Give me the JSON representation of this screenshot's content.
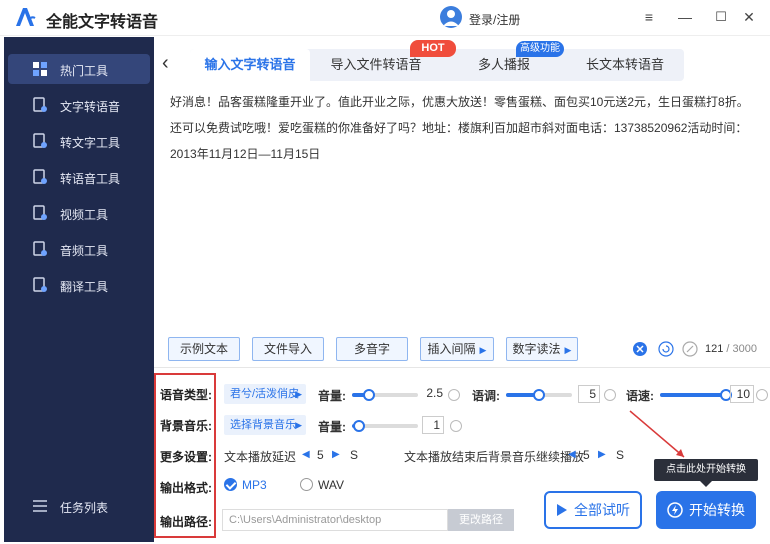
{
  "window": {
    "title": "全能文字转语音",
    "login": "登录/注册",
    "menu_icon": "≡",
    "min_icon": "—",
    "max_icon": "☐",
    "close_icon": "✕"
  },
  "sidebar": {
    "items": [
      {
        "label": "热门工具",
        "icon": "grid-icon"
      },
      {
        "label": "文字转语音",
        "icon": "text-to-speech-icon"
      },
      {
        "label": "转文字工具",
        "icon": "to-text-icon"
      },
      {
        "label": "转语音工具",
        "icon": "to-speech-icon"
      },
      {
        "label": "视频工具",
        "icon": "video-icon"
      },
      {
        "label": "音频工具",
        "icon": "audio-icon"
      },
      {
        "label": "翻译工具",
        "icon": "translate-icon"
      }
    ],
    "task_list": "任务列表"
  },
  "tabs": [
    {
      "label": "输入文字转语音"
    },
    {
      "label": "导入文件转语音"
    },
    {
      "label": "多人播报"
    },
    {
      "label": "长文本转语音"
    }
  ],
  "badges": {
    "hot": "HOT",
    "advanced": "高级功能"
  },
  "content": {
    "text": "好消息！品客蛋糕隆重开业了。值此开业之际，优惠大放送！零售蛋糕、面包买10元送2元，生日蛋糕打8折。还可以免费试吃哦！爱吃蛋糕的你准备好了吗？地址：楼旗利百加超市斜对面电话：13738520962活动时间：2013年11月12日—11月15日"
  },
  "toolbar": {
    "sample_text": "示例文本",
    "file_import": "文件导入",
    "polyphone": "多音字",
    "insert_pause": "插入间隔",
    "number_reading": "数字读法",
    "char_count": "121",
    "char_total": "/ 3000"
  },
  "settings": {
    "voice_type_label": "语音类型:",
    "voice_select": "君兮/活泼俏皮",
    "volume_label": "音量:",
    "volume_value": "2.5",
    "volume_level": 0.25,
    "pitch_label": "语调:",
    "pitch_value": "5",
    "pitch_level": 0.5,
    "speed_label": "语速:",
    "speed_value": "10",
    "speed_level": 1.0,
    "bgm_label": "背景音乐:",
    "bgm_select": "选择背景音乐",
    "bgm_volume_label": "音量:",
    "bgm_volume_value": "1",
    "bgm_volume_level": 0.1,
    "more_label": "更多设置:",
    "delay_label": "文本播放延迟",
    "delay_value": "5",
    "delay_unit": "S",
    "continue_label": "文本播放结束后背景音乐继续播放",
    "continue_value": "5",
    "continue_unit": "S",
    "format_label": "输出格式:",
    "format_mp3": "MP3",
    "format_wav": "WAV",
    "path_label": "输出路径:",
    "path_value": "C:\\Users\\Administrator\\desktop",
    "change_path": "更改路径"
  },
  "actions": {
    "preview_all": "全部试听",
    "start": "开始转换",
    "tooltip": "点击此处开始转换"
  },
  "colors": {
    "accent": "#2a73e8",
    "sidebar": "#1f2a4d",
    "highlight_box": "#d93a3a",
    "hot": "#f04d3c"
  }
}
